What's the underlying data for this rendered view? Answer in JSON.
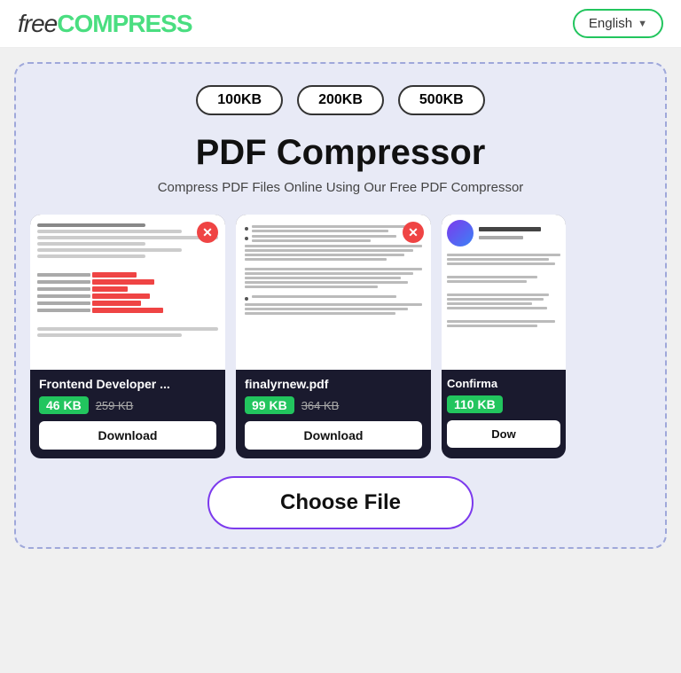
{
  "header": {
    "logo_free": "free",
    "logo_compress": "COMPRESS",
    "lang_button": "English",
    "lang_arrow": "▼"
  },
  "size_buttons": {
    "btn1": "100KB",
    "btn2": "200KB",
    "btn3": "500KB"
  },
  "main": {
    "title": "PDF Compressor",
    "subtitle": "Compress PDF Files Online Using Our Free PDF Compressor"
  },
  "cards": [
    {
      "filename": "Frontend Developer ...",
      "new_size": "46 KB",
      "old_size": "259 KB",
      "download_label": "Download"
    },
    {
      "filename": "finalyrnew.pdf",
      "new_size": "99 KB",
      "old_size": "364 KB",
      "download_label": "Download"
    },
    {
      "filename": "Confirma",
      "new_size": "110 KB",
      "old_size": "",
      "download_label": "Dow"
    }
  ],
  "choose_file": {
    "label": "Choose File"
  }
}
